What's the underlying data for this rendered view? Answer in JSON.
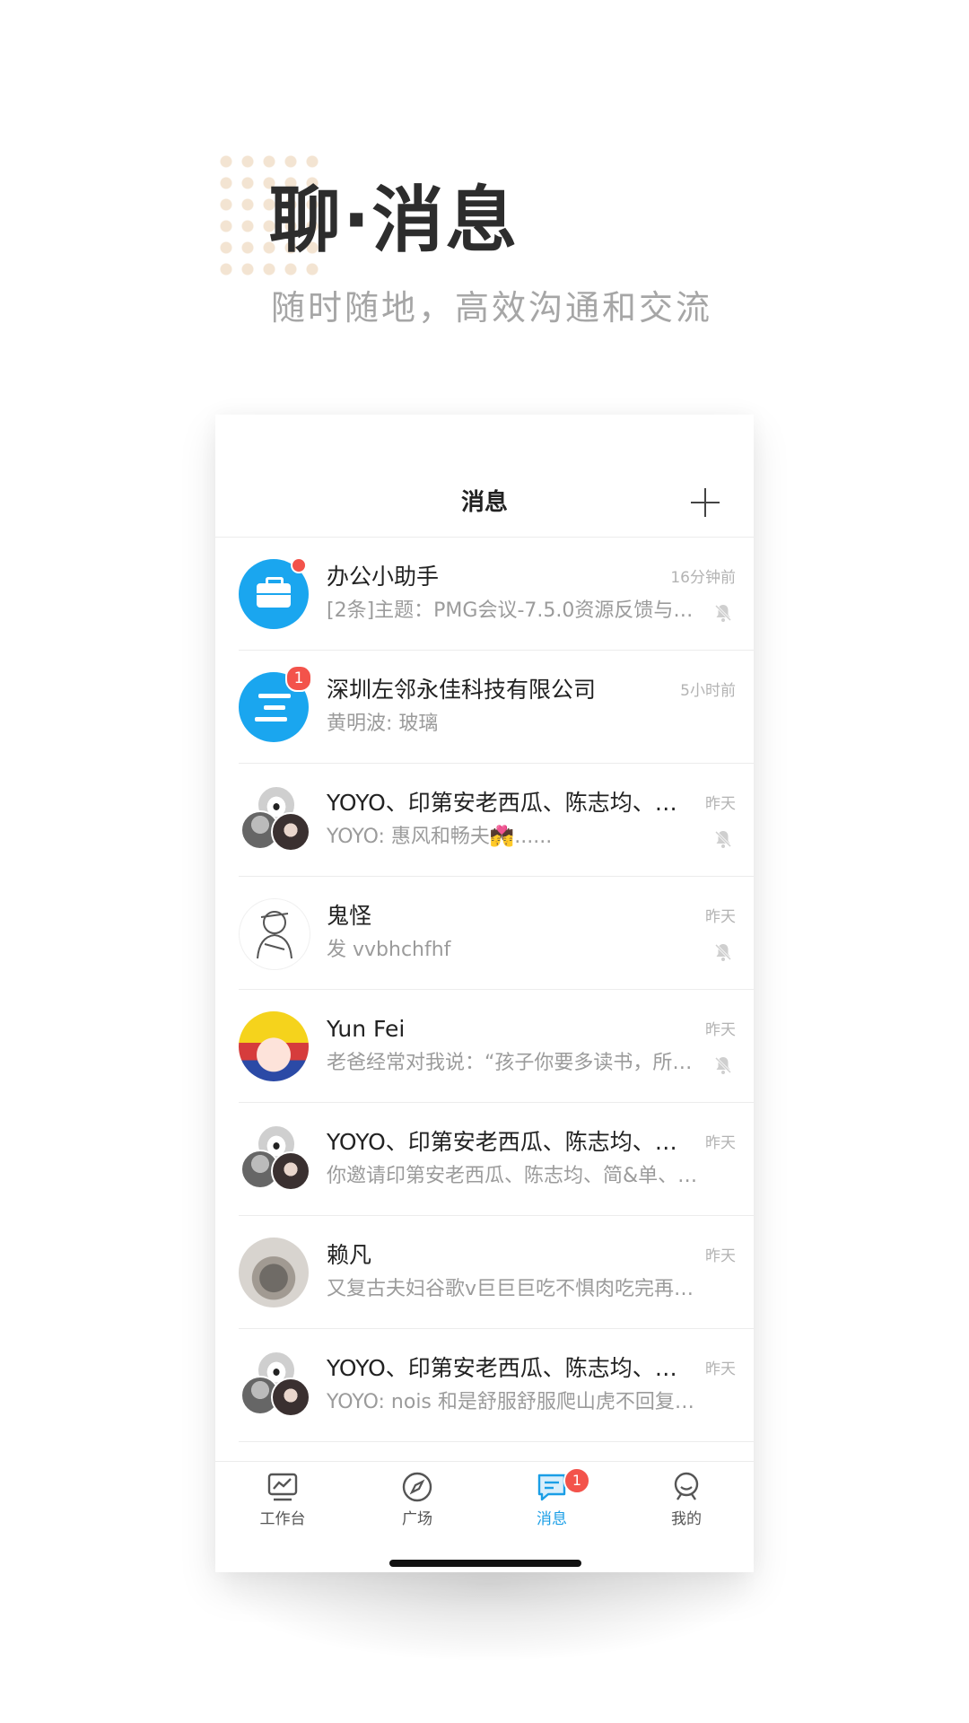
{
  "hero": {
    "title": "聊·消息",
    "subtitle": "随时随地，高效沟通和交流"
  },
  "nav": {
    "title": "消息",
    "add_icon": "plus-icon"
  },
  "conversations": [
    {
      "name": "办公小助手",
      "time": "16分钟前",
      "preview": "[2条]主题：PMG会议-7.5.0资源反馈与…",
      "avatar": "briefcase-icon",
      "badge": "dot",
      "muted": true
    },
    {
      "name": "深圳左邻永佳科技有限公司",
      "time": "5小时前",
      "preview": "黄明波: 玻璃",
      "avatar": "company-logo",
      "badge": "1",
      "muted": false
    },
    {
      "name": "YOYO、印第安老西瓜、陈志均、…",
      "time": "昨天",
      "preview": "YOYO: 惠风和畅夫💏......",
      "avatar": "group-avatar",
      "muted": true
    },
    {
      "name": "鬼怪",
      "time": "昨天",
      "preview": "发 vvbhchfhf",
      "avatar": "sketch-avatar",
      "muted": true
    },
    {
      "name": "Yun Fei",
      "time": "昨天",
      "preview": "老爸经常对我说：“孩子你要多读书，所…",
      "avatar": "cartoon-avatar",
      "muted": true
    },
    {
      "name": "YOYO、印第安老西瓜、陈志均、…",
      "time": "昨天",
      "preview": "你邀请印第安老西瓜、陈志均、简&单、…",
      "avatar": "group-avatar",
      "muted": false
    },
    {
      "name": "赖凡",
      "time": "昨天",
      "preview": "又复古夫妇谷歌v巨巨巨吃不惧肉吃完再…",
      "avatar": "dog-avatar",
      "muted": false
    },
    {
      "name": "YOYO、印第安老西瓜、陈志均、…",
      "time": "昨天",
      "preview": "YOYO: nois 和是舒服舒服爬山虎不回复…",
      "avatar": "group-avatar",
      "muted": false
    }
  ],
  "tabs": [
    {
      "label": "工作台",
      "icon": "workbench-icon"
    },
    {
      "label": "广场",
      "icon": "compass-icon"
    },
    {
      "label": "消息",
      "icon": "message-icon",
      "badge": "1",
      "active": true
    },
    {
      "label": "我的",
      "icon": "profile-icon"
    }
  ],
  "colors": {
    "accent": "#1a9ee6",
    "badge": "#f3534b",
    "avatar_blue": "#1aa6ef",
    "dots": "#f3e4d2"
  }
}
